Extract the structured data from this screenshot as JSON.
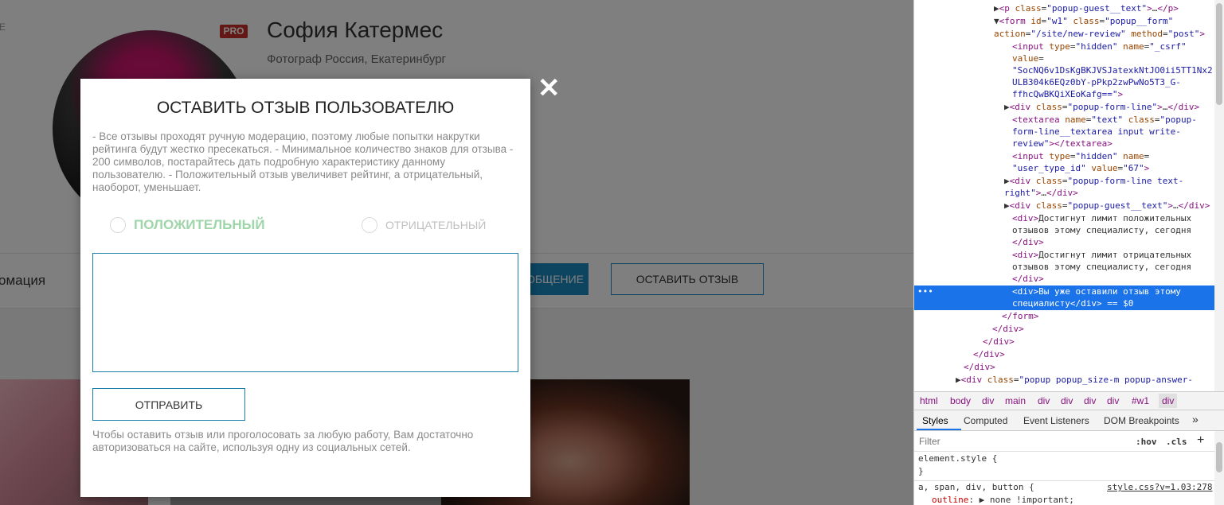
{
  "profile": {
    "edge_letter": "E",
    "pro_badge": "PRO",
    "name": "София Катермес",
    "subtitle": "Фотограф Россия, Екатеринбург"
  },
  "nav": {
    "info_tab": "омация",
    "message_button": "ОБЩЕНИЕ",
    "review_button": "ОСТАВИТЬ ОТЗЫВ"
  },
  "modal": {
    "close_symbol": "✕",
    "title": "ОСТАВИТЬ ОТЗЫВ ПОЛЬЗОВАТЕЛЮ",
    "text": "- Все отзывы проходят ручную модерацию, поэтому любые попытки накрутки рейтинга будут жестко пресекаться. - Минимальное количество знаков для отзыва - 200 символов, постарайтесь дать подробную характеристику данному пользователю. - Положительный отзыв увеличивет рейтинг, а отрицательный, наоборот, уменьшает.",
    "positive_label": "ПОЛОЖИТЕЛЬНЫЙ",
    "negative_label": "ОТРИЦАТЕЛЬНЫЙ",
    "textarea_value": "",
    "submit_label": "ОТПРАВИТЬ",
    "auth_text": "Чтобы оставить отзыв или проголосовать за любую работу, Вам достаточно авторизоваться на сайте, используя одну из социальных сетей.",
    "positive_color": "#9fd6a9",
    "border_color": "#1a7fa8"
  },
  "devtools": {
    "breadcrumbs": [
      "html",
      "body",
      "div",
      "main",
      "div",
      "div",
      "div",
      "div",
      "#w1",
      "div"
    ],
    "tabs": [
      "Styles",
      "Computed",
      "Event Listeners",
      "DOM Breakpoints",
      "»"
    ],
    "filter_placeholder": "Filter",
    "hov": ":hov",
    "cls": ".cls",
    "plus": "+",
    "element_style_open": "element.style {",
    "element_style_close": "}",
    "rule_selector": "a, span, div, button {",
    "rule_link": "style.css?v=1.03:278",
    "rule_prop": "outline",
    "rule_value": "none !important;",
    "selected_marker": "•••",
    "selection_color": "#1a73e8"
  }
}
